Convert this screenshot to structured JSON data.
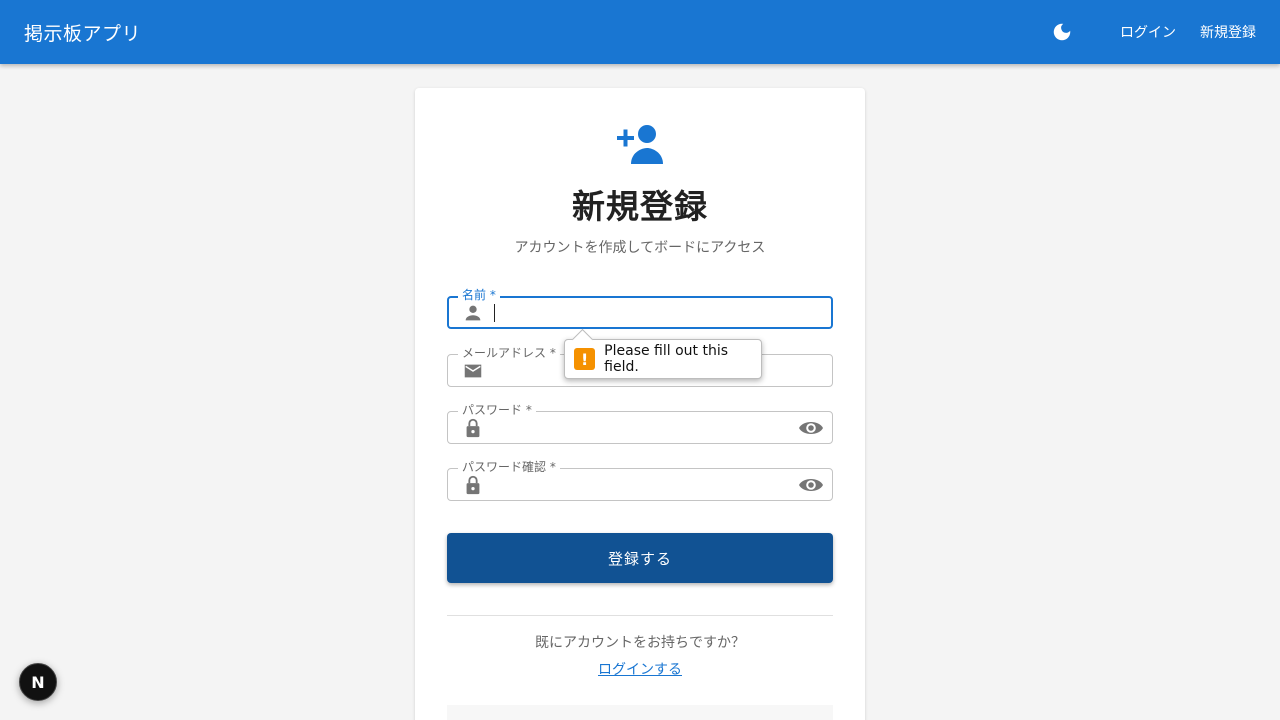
{
  "appbar": {
    "brand": "掲示板アプリ",
    "theme_icon": "moon-icon",
    "login_label": "ログイン",
    "register_label": "新規登録",
    "color": "#1976d2"
  },
  "card": {
    "hero_icon": "person-add-icon",
    "title": "新規登録",
    "subtitle": "アカウントを作成してボードにアクセス",
    "fields": [
      {
        "label": "名前 *",
        "icon": "person-icon",
        "value": ""
      },
      {
        "label": "メールアドレス *",
        "icon": "mail-icon",
        "value": ""
      },
      {
        "label": "パスワード *",
        "icon": "lock-icon",
        "value": "",
        "trailing_icon": "eye-icon"
      },
      {
        "label": "パスワード確認 *",
        "icon": "lock-icon",
        "value": "",
        "trailing_icon": "eye-icon"
      }
    ],
    "submit_label": "登録する",
    "have_account": "既にアカウントをお持ちですか？",
    "login_link": "ログインする"
  },
  "validation_tooltip": {
    "icon": "warning-icon",
    "warn_glyph": "!",
    "message": "Please fill out this field."
  },
  "dev_badge": {
    "label": "N"
  }
}
